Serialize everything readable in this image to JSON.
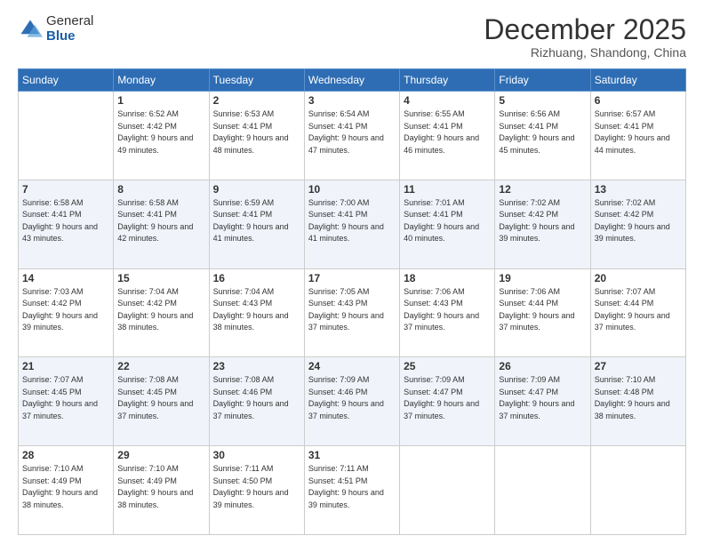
{
  "header": {
    "logo_general": "General",
    "logo_blue": "Blue",
    "month_title": "December 2025",
    "location": "Rizhuang, Shandong, China"
  },
  "weekdays": [
    "Sunday",
    "Monday",
    "Tuesday",
    "Wednesday",
    "Thursday",
    "Friday",
    "Saturday"
  ],
  "weeks": [
    [
      {
        "day": "",
        "sunrise": "",
        "sunset": "",
        "daylight": ""
      },
      {
        "day": "1",
        "sunrise": "6:52 AM",
        "sunset": "4:42 PM",
        "daylight": "9 hours and 49 minutes."
      },
      {
        "day": "2",
        "sunrise": "6:53 AM",
        "sunset": "4:41 PM",
        "daylight": "9 hours and 48 minutes."
      },
      {
        "day": "3",
        "sunrise": "6:54 AM",
        "sunset": "4:41 PM",
        "daylight": "9 hours and 47 minutes."
      },
      {
        "day": "4",
        "sunrise": "6:55 AM",
        "sunset": "4:41 PM",
        "daylight": "9 hours and 46 minutes."
      },
      {
        "day": "5",
        "sunrise": "6:56 AM",
        "sunset": "4:41 PM",
        "daylight": "9 hours and 45 minutes."
      },
      {
        "day": "6",
        "sunrise": "6:57 AM",
        "sunset": "4:41 PM",
        "daylight": "9 hours and 44 minutes."
      }
    ],
    [
      {
        "day": "7",
        "sunrise": "6:58 AM",
        "sunset": "4:41 PM",
        "daylight": "9 hours and 43 minutes."
      },
      {
        "day": "8",
        "sunrise": "6:58 AM",
        "sunset": "4:41 PM",
        "daylight": "9 hours and 42 minutes."
      },
      {
        "day": "9",
        "sunrise": "6:59 AM",
        "sunset": "4:41 PM",
        "daylight": "9 hours and 41 minutes."
      },
      {
        "day": "10",
        "sunrise": "7:00 AM",
        "sunset": "4:41 PM",
        "daylight": "9 hours and 41 minutes."
      },
      {
        "day": "11",
        "sunrise": "7:01 AM",
        "sunset": "4:41 PM",
        "daylight": "9 hours and 40 minutes."
      },
      {
        "day": "12",
        "sunrise": "7:02 AM",
        "sunset": "4:42 PM",
        "daylight": "9 hours and 39 minutes."
      },
      {
        "day": "13",
        "sunrise": "7:02 AM",
        "sunset": "4:42 PM",
        "daylight": "9 hours and 39 minutes."
      }
    ],
    [
      {
        "day": "14",
        "sunrise": "7:03 AM",
        "sunset": "4:42 PM",
        "daylight": "9 hours and 39 minutes."
      },
      {
        "day": "15",
        "sunrise": "7:04 AM",
        "sunset": "4:42 PM",
        "daylight": "9 hours and 38 minutes."
      },
      {
        "day": "16",
        "sunrise": "7:04 AM",
        "sunset": "4:43 PM",
        "daylight": "9 hours and 38 minutes."
      },
      {
        "day": "17",
        "sunrise": "7:05 AM",
        "sunset": "4:43 PM",
        "daylight": "9 hours and 37 minutes."
      },
      {
        "day": "18",
        "sunrise": "7:06 AM",
        "sunset": "4:43 PM",
        "daylight": "9 hours and 37 minutes."
      },
      {
        "day": "19",
        "sunrise": "7:06 AM",
        "sunset": "4:44 PM",
        "daylight": "9 hours and 37 minutes."
      },
      {
        "day": "20",
        "sunrise": "7:07 AM",
        "sunset": "4:44 PM",
        "daylight": "9 hours and 37 minutes."
      }
    ],
    [
      {
        "day": "21",
        "sunrise": "7:07 AM",
        "sunset": "4:45 PM",
        "daylight": "9 hours and 37 minutes."
      },
      {
        "day": "22",
        "sunrise": "7:08 AM",
        "sunset": "4:45 PM",
        "daylight": "9 hours and 37 minutes."
      },
      {
        "day": "23",
        "sunrise": "7:08 AM",
        "sunset": "4:46 PM",
        "daylight": "9 hours and 37 minutes."
      },
      {
        "day": "24",
        "sunrise": "7:09 AM",
        "sunset": "4:46 PM",
        "daylight": "9 hours and 37 minutes."
      },
      {
        "day": "25",
        "sunrise": "7:09 AM",
        "sunset": "4:47 PM",
        "daylight": "9 hours and 37 minutes."
      },
      {
        "day": "26",
        "sunrise": "7:09 AM",
        "sunset": "4:47 PM",
        "daylight": "9 hours and 37 minutes."
      },
      {
        "day": "27",
        "sunrise": "7:10 AM",
        "sunset": "4:48 PM",
        "daylight": "9 hours and 38 minutes."
      }
    ],
    [
      {
        "day": "28",
        "sunrise": "7:10 AM",
        "sunset": "4:49 PM",
        "daylight": "9 hours and 38 minutes."
      },
      {
        "day": "29",
        "sunrise": "7:10 AM",
        "sunset": "4:49 PM",
        "daylight": "9 hours and 38 minutes."
      },
      {
        "day": "30",
        "sunrise": "7:11 AM",
        "sunset": "4:50 PM",
        "daylight": "9 hours and 39 minutes."
      },
      {
        "day": "31",
        "sunrise": "7:11 AM",
        "sunset": "4:51 PM",
        "daylight": "9 hours and 39 minutes."
      },
      {
        "day": "",
        "sunrise": "",
        "sunset": "",
        "daylight": ""
      },
      {
        "day": "",
        "sunrise": "",
        "sunset": "",
        "daylight": ""
      },
      {
        "day": "",
        "sunrise": "",
        "sunset": "",
        "daylight": ""
      }
    ]
  ]
}
